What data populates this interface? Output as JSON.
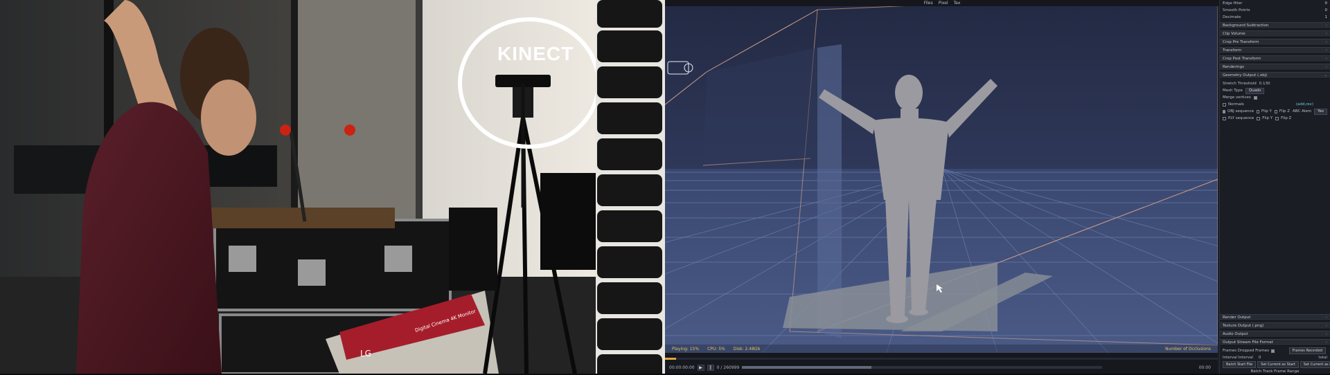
{
  "photo": {
    "kinect_label": "KINECT",
    "box_brand": "LG",
    "box_text": "Digital Cinema 4K Monitor"
  },
  "app": {
    "topbar": [
      "Files",
      "Pixel",
      "Tex"
    ],
    "viewport": {
      "status_left": [
        "Playing: 15%",
        "CPU: 5%",
        "Disk: 2.48Gb"
      ],
      "status_right": "Number of Occlusions"
    },
    "timeline": {
      "time_label": "00:00:00:00",
      "frame_label": "0 / 260999",
      "end_label": "00:00",
      "progress": 0.02,
      "scrub_progress": 0.36
    },
    "panel": {
      "top_rows": [
        {
          "label": "Edge filter",
          "value": "0"
        },
        {
          "label": "Smooth Points",
          "value": "0"
        },
        {
          "label": "Decimate",
          "value": "1"
        }
      ],
      "headers": [
        "Background Subtraction",
        "Clip Volume",
        "Crop Pre Transform",
        "Transform",
        "Crop Post Transform",
        "Renderings",
        "Geometry Output (.obj)"
      ],
      "geometry_rows": {
        "stretch_label": "Stretch Threshold",
        "stretch_value": "0.130",
        "mesh_type_label": "Mesh Type",
        "mesh_type_value": "Quads",
        "merge_label": "Merge vertices",
        "normals_label": "Normals",
        "normals_cyan": "(add,rev)",
        "obj_sequence": "OBJ sequence",
        "ply_sequence": "PLY sequence",
        "flip_y": "Flip Y",
        "flip_z": "Flip Z",
        "alembic": "ABC Alem",
        "alembic_value": "Yes"
      },
      "bottom_headers": [
        "Render Output",
        "Texture Output (.png)",
        "Audio Output",
        "Output Stream File Format"
      ],
      "bottom_rows": {
        "frames_label": "Frames Dropped Frames",
        "frames_button": "Frames Recorded",
        "interval_label": "Interval Interval",
        "interval_value": "0",
        "interval_unit": "total",
        "buttons": [
          "Batch Start File",
          "Set Current as Start",
          "Set Current as End"
        ],
        "footer": "Batch Track Frame Range"
      }
    }
  }
}
